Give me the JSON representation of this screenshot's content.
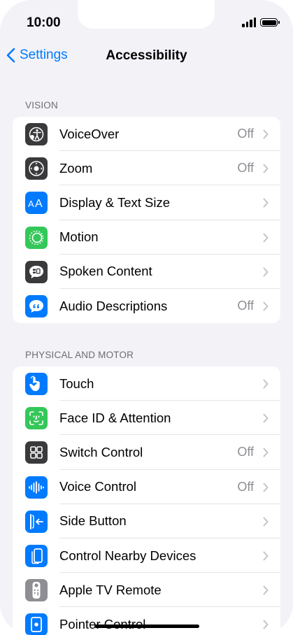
{
  "status_bar": {
    "time": "10:00"
  },
  "nav": {
    "back_label": "Settings",
    "title": "Accessibility"
  },
  "sections": [
    {
      "header": "VISION",
      "rows": [
        {
          "label": "VoiceOver",
          "value": "Off",
          "icon": "voiceover-icon",
          "color": "#3a3a3c"
        },
        {
          "label": "Zoom",
          "value": "Off",
          "icon": "zoom-icon",
          "color": "#3a3a3c"
        },
        {
          "label": "Display & Text Size",
          "value": "",
          "icon": "text-size-icon",
          "color": "#007aff"
        },
        {
          "label": "Motion",
          "value": "",
          "icon": "motion-icon",
          "color": "#34c759"
        },
        {
          "label": "Spoken Content",
          "value": "",
          "icon": "spoken-content-icon",
          "color": "#3a3a3c"
        },
        {
          "label": "Audio Descriptions",
          "value": "Off",
          "icon": "audio-descriptions-icon",
          "color": "#007aff"
        }
      ]
    },
    {
      "header": "PHYSICAL AND MOTOR",
      "rows": [
        {
          "label": "Touch",
          "value": "",
          "icon": "touch-icon",
          "color": "#007aff"
        },
        {
          "label": "Face ID & Attention",
          "value": "",
          "icon": "face-id-icon",
          "color": "#34c759"
        },
        {
          "label": "Switch Control",
          "value": "Off",
          "icon": "switch-control-icon",
          "color": "#3a3a3c"
        },
        {
          "label": "Voice Control",
          "value": "Off",
          "icon": "voice-control-icon",
          "color": "#007aff"
        },
        {
          "label": "Side Button",
          "value": "",
          "icon": "side-button-icon",
          "color": "#007aff"
        },
        {
          "label": "Control Nearby Devices",
          "value": "",
          "icon": "nearby-devices-icon",
          "color": "#007aff"
        },
        {
          "label": "Apple TV Remote",
          "value": "",
          "icon": "tv-remote-icon",
          "color": "#8e8e93"
        },
        {
          "label": "Pointer Control",
          "value": "",
          "icon": "pointer-control-icon",
          "color": "#007aff"
        }
      ]
    }
  ]
}
